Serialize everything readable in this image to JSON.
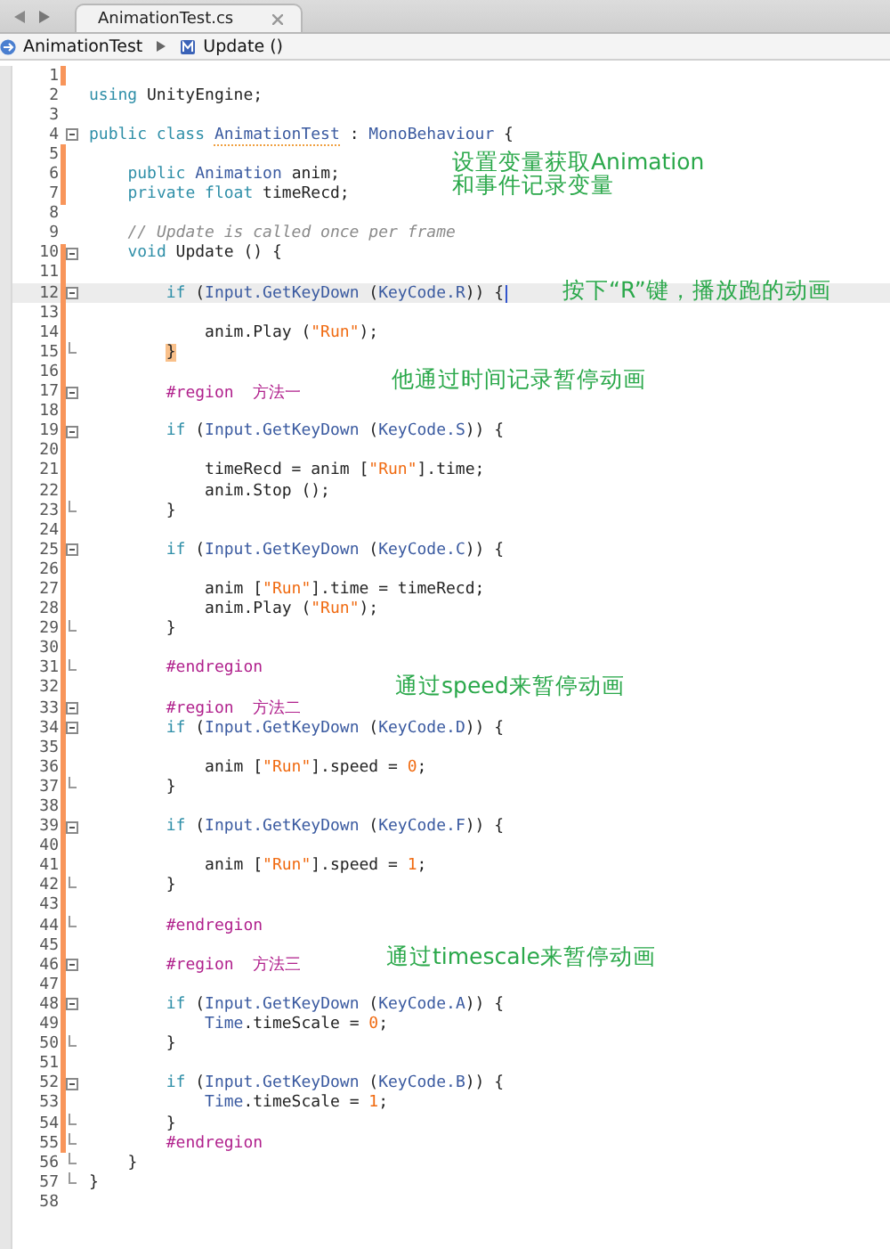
{
  "tabs": [
    {
      "label": "AnimationTest.cs",
      "selected": true
    }
  ],
  "breadcrumb": [
    {
      "label": "AnimationTest",
      "kind": "class"
    },
    {
      "label": "Update ()",
      "kind": "method"
    }
  ],
  "lines": [
    {
      "number": "1",
      "modified": true,
      "kind": "plain"
    },
    {
      "number": "2",
      "modified": false,
      "kind": "plain",
      "tokens": [
        {
          "text": "using",
          "kind": "kw"
        },
        {
          "text": " UnityEngine;",
          "kind": "plain"
        }
      ]
    },
    {
      "number": "3",
      "modified": false,
      "kind": "plain"
    },
    {
      "number": "4",
      "modified": false,
      "kind": "block-start",
      "tokens": [
        {
          "text": "public class ",
          "kind": "kw"
        },
        {
          "text": "AnimationTest",
          "kind": "warn"
        },
        {
          "text": " : ",
          "kind": "plain"
        },
        {
          "text": "MonoBehaviour",
          "kind": "type"
        },
        {
          "text": " {",
          "kind": "plain"
        }
      ]
    },
    {
      "number": "5",
      "modified": true,
      "kind": "plain"
    },
    {
      "number": "6",
      "modified": true,
      "kind": "plain",
      "tokens": [
        {
          "text": "public ",
          "kind": "kw"
        },
        {
          "text": "Animation",
          "kind": "type"
        },
        {
          "text": " anim;",
          "kind": "plain"
        }
      ],
      "note": "设置变量获取Animation\n和事件记录变量"
    },
    {
      "number": "7",
      "modified": true,
      "kind": "plain",
      "tokens": [
        {
          "text": "private float",
          "kind": "kw"
        },
        {
          "text": " timeRecd;",
          "kind": "plain"
        }
      ]
    },
    {
      "number": "8",
      "modified": false,
      "kind": "plain"
    },
    {
      "number": "9",
      "modified": false,
      "kind": "plain",
      "tokens": [
        {
          "text": "// Update is called once per frame",
          "kind": "comment"
        }
      ]
    },
    {
      "number": "10",
      "modified": true,
      "kind": "block-start",
      "tokens": [
        {
          "text": "void",
          "kind": "kw"
        },
        {
          "text": " Update () {",
          "kind": "plain"
        }
      ]
    },
    {
      "number": "11",
      "modified": true,
      "kind": "plain"
    },
    {
      "number": "12",
      "modified": true,
      "kind": "block-start",
      "current": true,
      "tokens": [
        {
          "text": "if",
          "kind": "kw"
        },
        {
          "text": " (",
          "kind": "plain"
        },
        {
          "text": "Input.GetKeyDown",
          "kind": "type"
        },
        {
          "text": " (",
          "kind": "plain"
        },
        {
          "text": "KeyCode.R",
          "kind": "type"
        },
        {
          "text": ")) {",
          "kind": "plain"
        }
      ],
      "note": "按下“R”键，播放跑的动画"
    },
    {
      "number": "13",
      "modified": true,
      "kind": "plain"
    },
    {
      "number": "14",
      "modified": true,
      "kind": "plain",
      "tokens": [
        {
          "text": "anim.Play (",
          "kind": "plain"
        },
        {
          "text": "\"Run\"",
          "kind": "str"
        },
        {
          "text": ");",
          "kind": "plain"
        }
      ]
    },
    {
      "number": "15",
      "modified": true,
      "kind": "block-end",
      "tokens": [
        {
          "text": "}",
          "kind": "match"
        }
      ]
    },
    {
      "number": "16",
      "modified": true,
      "kind": "plain"
    },
    {
      "number": "17",
      "modified": true,
      "kind": "region-start",
      "tokens": [
        {
          "text": "#region  方法一",
          "kind": "dir"
        }
      ],
      "note": "他通过时间记录暂停动画"
    },
    {
      "number": "18",
      "modified": true,
      "kind": "plain"
    },
    {
      "number": "19",
      "modified": true,
      "kind": "block-start",
      "tokens": [
        {
          "text": "if",
          "kind": "kw"
        },
        {
          "text": " (",
          "kind": "plain"
        },
        {
          "text": "Input.GetKeyDown",
          "kind": "type"
        },
        {
          "text": " (",
          "kind": "plain"
        },
        {
          "text": "KeyCode.S",
          "kind": "type"
        },
        {
          "text": ")) {",
          "kind": "plain"
        }
      ]
    },
    {
      "number": "20",
      "modified": true,
      "kind": "plain"
    },
    {
      "number": "21",
      "modified": true,
      "kind": "plain",
      "tokens": [
        {
          "text": "timeRecd = anim [",
          "kind": "plain"
        },
        {
          "text": "\"Run\"",
          "kind": "str"
        },
        {
          "text": "].time;",
          "kind": "plain"
        }
      ]
    },
    {
      "number": "22",
      "modified": true,
      "kind": "plain",
      "tokens": [
        {
          "text": "anim.Stop ();",
          "kind": "plain"
        }
      ]
    },
    {
      "number": "23",
      "modified": true,
      "kind": "block-end",
      "tokens": [
        {
          "text": "}",
          "kind": "plain"
        }
      ]
    },
    {
      "number": "24",
      "modified": true,
      "kind": "plain"
    },
    {
      "number": "25",
      "modified": true,
      "kind": "block-start",
      "tokens": [
        {
          "text": "if",
          "kind": "kw"
        },
        {
          "text": " (",
          "kind": "plain"
        },
        {
          "text": "Input.GetKeyDown",
          "kind": "type"
        },
        {
          "text": " (",
          "kind": "plain"
        },
        {
          "text": "KeyCode.C",
          "kind": "type"
        },
        {
          "text": ")) {",
          "kind": "plain"
        }
      ]
    },
    {
      "number": "26",
      "modified": true,
      "kind": "plain"
    },
    {
      "number": "27",
      "modified": true,
      "kind": "plain",
      "tokens": [
        {
          "text": "anim [",
          "kind": "plain"
        },
        {
          "text": "\"Run\"",
          "kind": "str"
        },
        {
          "text": "].time = timeRecd;",
          "kind": "plain"
        }
      ]
    },
    {
      "number": "28",
      "modified": true,
      "kind": "plain",
      "tokens": [
        {
          "text": "anim.Play (",
          "kind": "plain"
        },
        {
          "text": "\"Run\"",
          "kind": "str"
        },
        {
          "text": ");",
          "kind": "plain"
        }
      ]
    },
    {
      "number": "29",
      "modified": true,
      "kind": "block-end",
      "tokens": [
        {
          "text": "}",
          "kind": "plain"
        }
      ]
    },
    {
      "number": "30",
      "modified": true,
      "kind": "plain"
    },
    {
      "number": "31",
      "modified": true,
      "kind": "region-end",
      "tokens": [
        {
          "text": "#endregion",
          "kind": "dir"
        }
      ]
    },
    {
      "number": "32",
      "modified": true,
      "kind": "plain",
      "note": "通过speed来暂停动画"
    },
    {
      "number": "33",
      "modified": true,
      "kind": "region-start",
      "tokens": [
        {
          "text": "#region  方法二",
          "kind": "dir"
        }
      ]
    },
    {
      "number": "34",
      "modified": true,
      "kind": "block-start",
      "tokens": [
        {
          "text": "if",
          "kind": "kw"
        },
        {
          "text": " (",
          "kind": "plain"
        },
        {
          "text": "Input.GetKeyDown",
          "kind": "type"
        },
        {
          "text": " (",
          "kind": "plain"
        },
        {
          "text": "KeyCode.D",
          "kind": "type"
        },
        {
          "text": ")) {",
          "kind": "plain"
        }
      ]
    },
    {
      "number": "35",
      "modified": true,
      "kind": "plain"
    },
    {
      "number": "36",
      "modified": true,
      "kind": "plain",
      "tokens": [
        {
          "text": "anim [",
          "kind": "plain"
        },
        {
          "text": "\"Run\"",
          "kind": "str"
        },
        {
          "text": "].speed = ",
          "kind": "plain"
        },
        {
          "text": "0",
          "kind": "num"
        },
        {
          "text": ";",
          "kind": "plain"
        }
      ]
    },
    {
      "number": "37",
      "modified": true,
      "kind": "block-end",
      "tokens": [
        {
          "text": "}",
          "kind": "plain"
        }
      ]
    },
    {
      "number": "38",
      "modified": true,
      "kind": "plain"
    },
    {
      "number": "39",
      "modified": true,
      "kind": "block-start",
      "tokens": [
        {
          "text": "if",
          "kind": "kw"
        },
        {
          "text": " (",
          "kind": "plain"
        },
        {
          "text": "Input.GetKeyDown",
          "kind": "type"
        },
        {
          "text": " (",
          "kind": "plain"
        },
        {
          "text": "KeyCode.F",
          "kind": "type"
        },
        {
          "text": ")) {",
          "kind": "plain"
        }
      ]
    },
    {
      "number": "40",
      "modified": true,
      "kind": "plain"
    },
    {
      "number": "41",
      "modified": true,
      "kind": "plain",
      "tokens": [
        {
          "text": "anim [",
          "kind": "plain"
        },
        {
          "text": "\"Run\"",
          "kind": "str"
        },
        {
          "text": "].speed = ",
          "kind": "plain"
        },
        {
          "text": "1",
          "kind": "num"
        },
        {
          "text": ";",
          "kind": "plain"
        }
      ]
    },
    {
      "number": "42",
      "modified": true,
      "kind": "block-end",
      "tokens": [
        {
          "text": "}",
          "kind": "plain"
        }
      ]
    },
    {
      "number": "43",
      "modified": true,
      "kind": "plain"
    },
    {
      "number": "44",
      "modified": true,
      "kind": "region-end",
      "tokens": [
        {
          "text": "#endregion",
          "kind": "dir"
        }
      ]
    },
    {
      "number": "45",
      "modified": true,
      "kind": "plain"
    },
    {
      "number": "46",
      "modified": true,
      "kind": "region-start",
      "tokens": [
        {
          "text": "#region  方法三",
          "kind": "dir"
        }
      ],
      "note": "通过timescale来暂停动画"
    },
    {
      "number": "47",
      "modified": true,
      "kind": "plain"
    },
    {
      "number": "48",
      "modified": true,
      "kind": "block-start",
      "tokens": [
        {
          "text": "if",
          "kind": "kw"
        },
        {
          "text": " (",
          "kind": "plain"
        },
        {
          "text": "Input.GetKeyDown",
          "kind": "type"
        },
        {
          "text": " (",
          "kind": "plain"
        },
        {
          "text": "KeyCode.A",
          "kind": "type"
        },
        {
          "text": ")) {",
          "kind": "plain"
        }
      ]
    },
    {
      "number": "49",
      "modified": true,
      "kind": "plain",
      "tokens": [
        {
          "text": "Time",
          "kind": "type"
        },
        {
          "text": ".timeScale = ",
          "kind": "plain"
        },
        {
          "text": "0",
          "kind": "num"
        },
        {
          "text": ";",
          "kind": "plain"
        }
      ]
    },
    {
      "number": "50",
      "modified": true,
      "kind": "block-end",
      "tokens": [
        {
          "text": "}",
          "kind": "plain"
        }
      ]
    },
    {
      "number": "51",
      "modified": true,
      "kind": "plain"
    },
    {
      "number": "52",
      "modified": true,
      "kind": "block-start",
      "tokens": [
        {
          "text": "if",
          "kind": "kw"
        },
        {
          "text": " (",
          "kind": "plain"
        },
        {
          "text": "Input.GetKeyDown",
          "kind": "type"
        },
        {
          "text": " (",
          "kind": "plain"
        },
        {
          "text": "KeyCode.B",
          "kind": "type"
        },
        {
          "text": ")) {",
          "kind": "plain"
        }
      ]
    },
    {
      "number": "53",
      "modified": true,
      "kind": "plain",
      "tokens": [
        {
          "text": "Time",
          "kind": "type"
        },
        {
          "text": ".timeScale = ",
          "kind": "plain"
        },
        {
          "text": "1",
          "kind": "num"
        },
        {
          "text": ";",
          "kind": "plain"
        }
      ]
    },
    {
      "number": "54",
      "modified": true,
      "kind": "block-end",
      "tokens": [
        {
          "text": "}",
          "kind": "plain"
        }
      ]
    },
    {
      "number": "55",
      "modified": true,
      "kind": "region-end",
      "tokens": [
        {
          "text": "#endregion",
          "kind": "dir"
        }
      ]
    },
    {
      "number": "56",
      "modified": false,
      "kind": "block-end",
      "tokens": [
        {
          "text": "}",
          "kind": "plain"
        }
      ]
    },
    {
      "number": "57",
      "modified": false,
      "kind": "block-end",
      "tokens": [
        {
          "text": "}",
          "kind": "plain"
        }
      ]
    },
    {
      "number": "58",
      "modified": false,
      "kind": "plain"
    }
  ]
}
